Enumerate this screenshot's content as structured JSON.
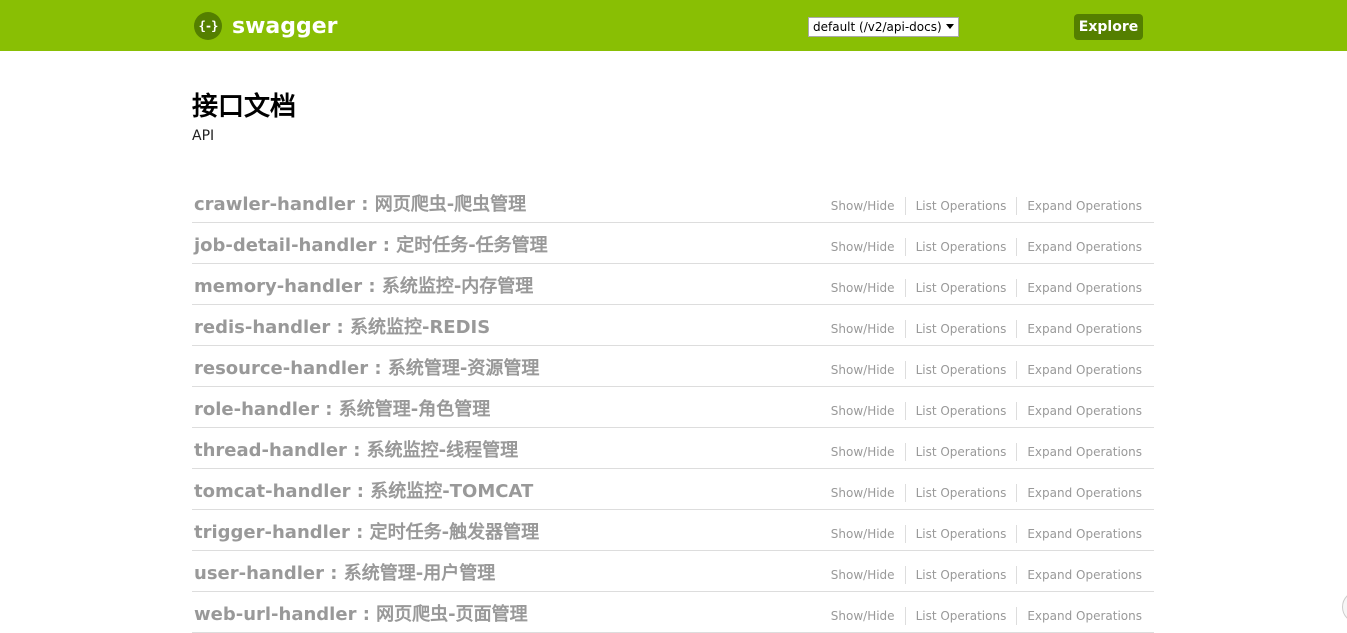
{
  "header": {
    "logo_icon": "{-}",
    "logo_text": "swagger",
    "spec_select_value": "default (/v2/api-docs)",
    "explore_label": "Explore"
  },
  "info": {
    "title": "接口文档",
    "description": "API"
  },
  "ops_labels": {
    "show_hide": "Show/Hide",
    "list": "List Operations",
    "expand": "Expand Operations"
  },
  "resources": [
    {
      "name": "crawler-handler : 网页爬虫-爬虫管理"
    },
    {
      "name": "job-detail-handler : 定时任务-任务管理"
    },
    {
      "name": "memory-handler : 系统监控-内存管理"
    },
    {
      "name": "redis-handler : 系统监控-REDIS"
    },
    {
      "name": "resource-handler : 系统管理-资源管理"
    },
    {
      "name": "role-handler : 系统管理-角色管理"
    },
    {
      "name": "thread-handler : 系统监控-线程管理"
    },
    {
      "name": "tomcat-handler : 系统监控-TOMCAT"
    },
    {
      "name": "trigger-handler : 定时任务-触发器管理"
    },
    {
      "name": "user-handler : 系统管理-用户管理"
    },
    {
      "name": "web-url-handler : 网页爬虫-页面管理"
    }
  ],
  "colors": {
    "header_bg": "#89bf04",
    "button_bg": "#547f00",
    "resource_text": "#999999"
  }
}
